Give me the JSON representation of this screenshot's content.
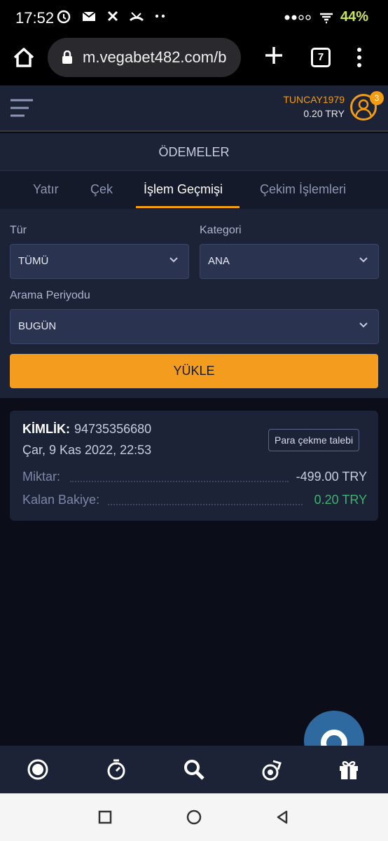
{
  "status_bar": {
    "time": "17:52",
    "battery": "44%",
    "icons": [
      "alarm-icon",
      "mail-icon",
      "x-icon",
      "missed-call-icon",
      "more-dots-icon",
      "signal-icon",
      "wifi-icon"
    ]
  },
  "browser": {
    "url": "m.vegabet482.com/b",
    "tab_count": "7",
    "icons": [
      "home-icon",
      "lock-icon",
      "plus-icon",
      "more-vert-icon"
    ]
  },
  "header": {
    "username": "TUNCAY1979",
    "balance": "0.20 TRY",
    "notification_count": "3"
  },
  "section_title": "ÖDEMELER",
  "tabs": [
    {
      "label": "Yatır",
      "active": false
    },
    {
      "label": "Çek",
      "active": false
    },
    {
      "label": "İşlem Geçmişi",
      "active": true
    },
    {
      "label": "Çekim İşlemleri",
      "active": false
    }
  ],
  "filters": {
    "type_label": "Tür",
    "type_value": "TÜMÜ",
    "category_label": "Kategori",
    "category_value": "ANA",
    "period_label": "Arama Periyodu",
    "period_value": "BUGÜN",
    "load_button": "YÜKLE"
  },
  "transaction": {
    "id_label": "KİMLİK:",
    "id_value": "94735356680",
    "date": "Çar, 9 Kas 2022, 22:53",
    "tag": "Para çekme talebi",
    "amount_label": "Miktar:",
    "amount_value": "-499.00 TRY",
    "balance_label": "Kalan Bakiye:",
    "balance_value": "0.20 TRY"
  },
  "colors": {
    "accent": "#f39c12",
    "panel": "#1c2336",
    "background": "#0b0e18",
    "positive": "#3cb371"
  },
  "bottom_nav_icons": [
    "live-icon",
    "stopwatch-icon",
    "search-icon",
    "casino-chip-icon",
    "gift-icon"
  ],
  "android_nav_icons": [
    "recents-icon",
    "home-circle-icon",
    "back-icon"
  ]
}
